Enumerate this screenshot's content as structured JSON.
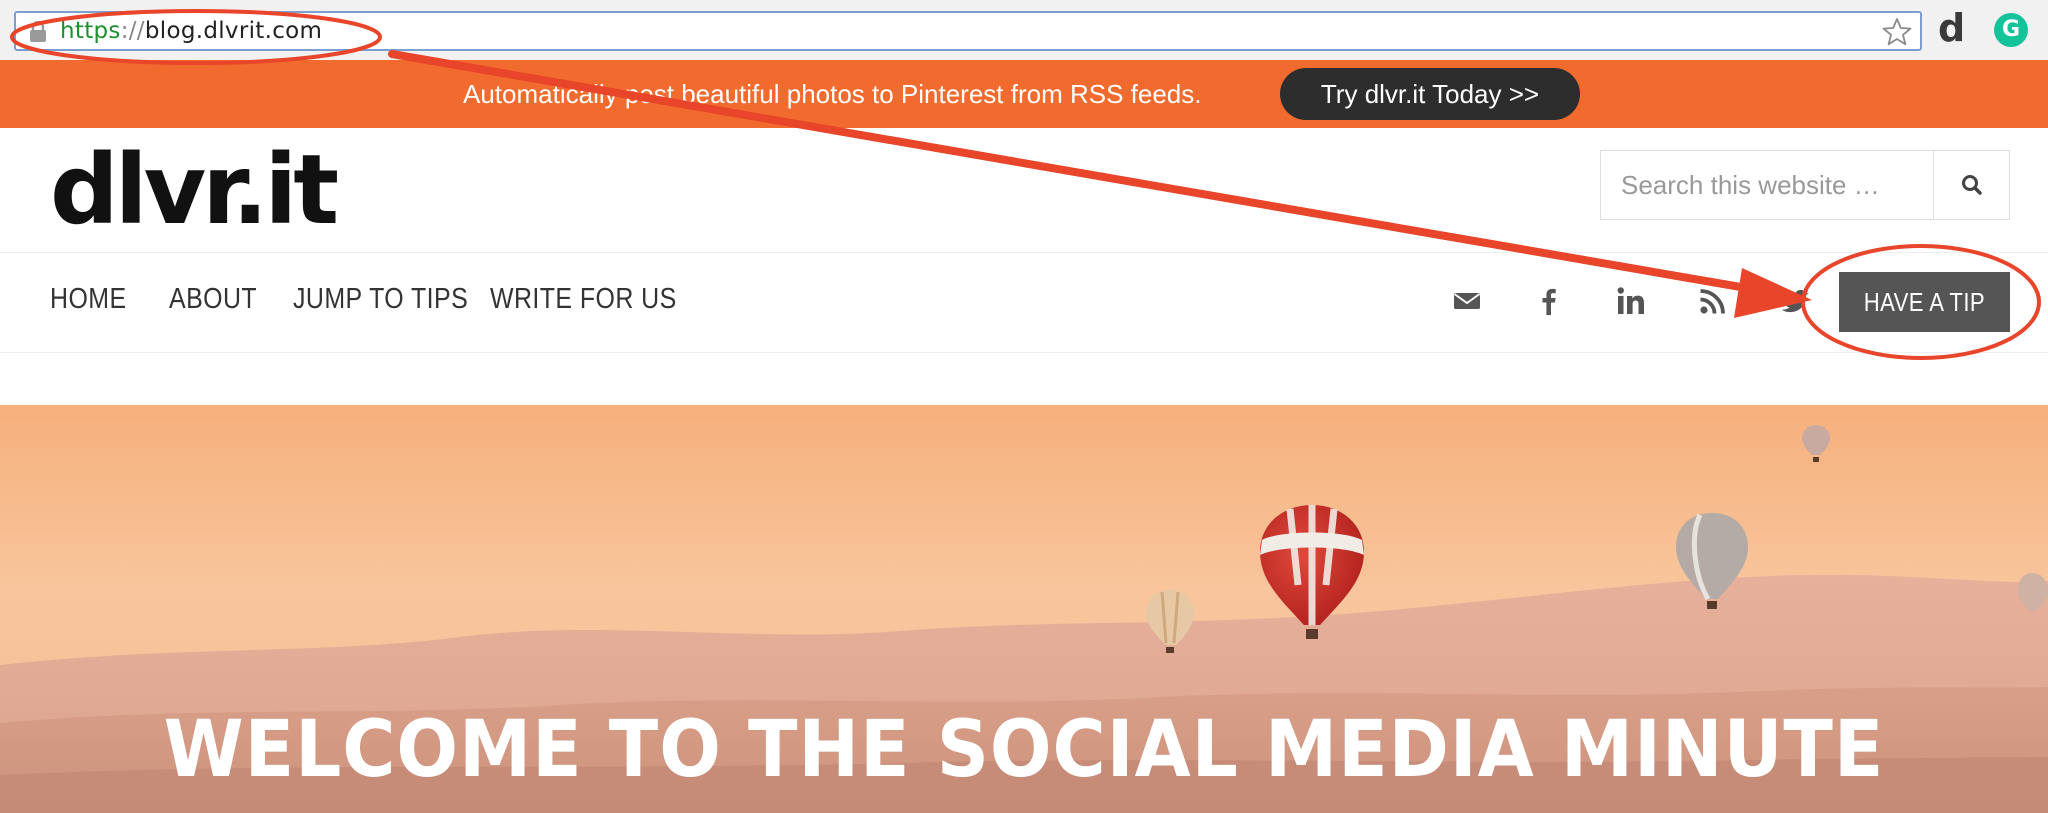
{
  "browser": {
    "url_scheme": "https",
    "url_separator": "://",
    "url_host": "blog.dlvrit.com",
    "extensions": [
      "d",
      "G"
    ]
  },
  "promo": {
    "text": "Automatically post beautiful photos to Pinterest from RSS feeds.",
    "button": "Try dlvr.it Today >>"
  },
  "header": {
    "logo": "dlvr.it",
    "search_placeholder": "Search this website …"
  },
  "nav": {
    "items": [
      "HOME",
      "ABOUT",
      "JUMP TO TIPS",
      "WRITE FOR US"
    ],
    "social_icons": [
      "email-icon",
      "facebook-icon",
      "linkedin-icon",
      "rss-icon",
      "twitter-icon"
    ],
    "cta": "HAVE A TIP"
  },
  "hero": {
    "title": "WELCOME TO THE SOCIAL MEDIA MINUTE"
  },
  "colors": {
    "promo_bg": "#f26b2e",
    "promo_button_bg": "#2d2d2d",
    "cta_bg": "#555555",
    "annotation_red": "#e8452a",
    "url_scheme_green": "#1e8f2e"
  }
}
